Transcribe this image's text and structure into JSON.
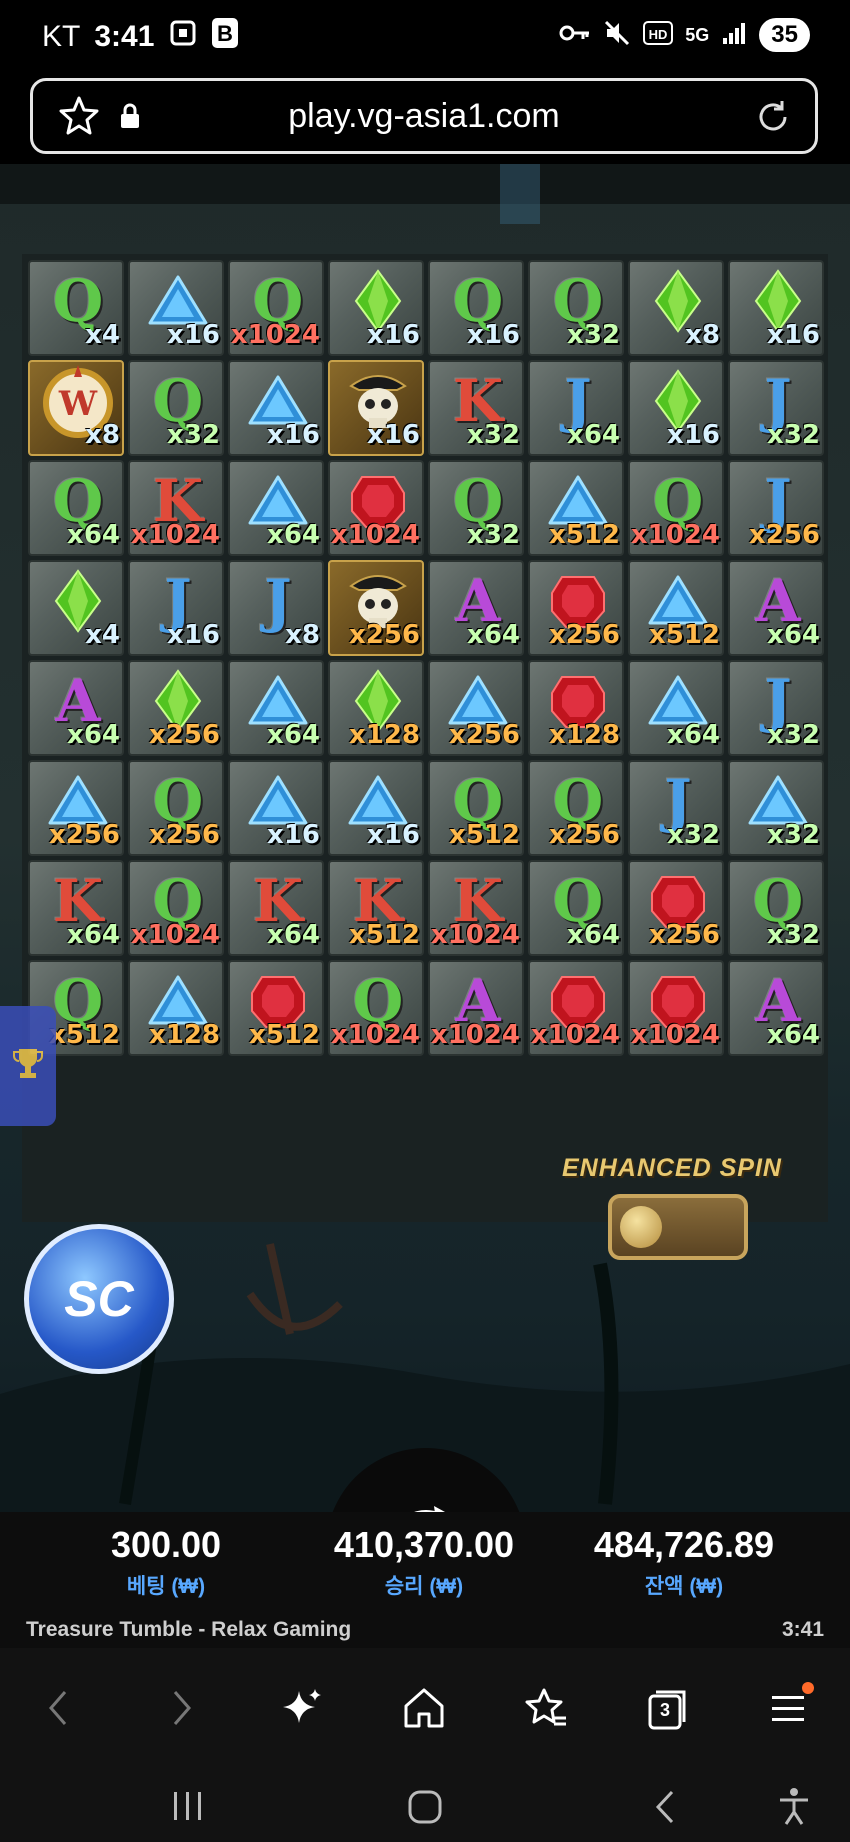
{
  "status_bar": {
    "carrier": "KT",
    "time": "3:41",
    "network": "5G",
    "battery": "35"
  },
  "browser": {
    "url": "play.vg-asia1.com"
  },
  "grid": {
    "rows": [
      [
        {
          "s": "Q",
          "m": "x4"
        },
        {
          "s": "tri",
          "m": "x16"
        },
        {
          "s": "Q",
          "m": "x1024"
        },
        {
          "s": "gem",
          "m": "x16"
        },
        {
          "s": "Q",
          "m": "x16"
        },
        {
          "s": "Q",
          "m": "x32"
        },
        {
          "s": "gem",
          "m": "x8"
        },
        {
          "s": "gem",
          "m": "x16"
        }
      ],
      [
        {
          "s": "W",
          "m": "x8"
        },
        {
          "s": "Q",
          "m": "x32"
        },
        {
          "s": "tri",
          "m": "x16"
        },
        {
          "s": "skull",
          "m": "x16"
        },
        {
          "s": "K",
          "m": "x32"
        },
        {
          "s": "J",
          "m": "x64"
        },
        {
          "s": "gem",
          "m": "x16"
        },
        {
          "s": "J",
          "m": "x32"
        }
      ],
      [
        {
          "s": "Q",
          "m": "x64"
        },
        {
          "s": "K",
          "m": "x1024"
        },
        {
          "s": "tri",
          "m": "x64"
        },
        {
          "s": "ruby",
          "m": "x1024"
        },
        {
          "s": "Q",
          "m": "x32"
        },
        {
          "s": "tri",
          "m": "x512"
        },
        {
          "s": "Q",
          "m": "x1024"
        },
        {
          "s": "J",
          "m": "x256"
        }
      ],
      [
        {
          "s": "gem",
          "m": "x4"
        },
        {
          "s": "J",
          "m": "x16"
        },
        {
          "s": "J",
          "m": "x8"
        },
        {
          "s": "skull",
          "m": "x256"
        },
        {
          "s": "A",
          "m": "x64"
        },
        {
          "s": "ruby",
          "m": "x256"
        },
        {
          "s": "tri",
          "m": "x512"
        },
        {
          "s": "A",
          "m": "x64"
        }
      ],
      [
        {
          "s": "A",
          "m": "x64"
        },
        {
          "s": "gem",
          "m": "x256"
        },
        {
          "s": "tri",
          "m": "x64"
        },
        {
          "s": "gem",
          "m": "x128"
        },
        {
          "s": "tri",
          "m": "x256"
        },
        {
          "s": "ruby",
          "m": "x128"
        },
        {
          "s": "tri",
          "m": "x64"
        },
        {
          "s": "J",
          "m": "x32"
        }
      ],
      [
        {
          "s": "tri",
          "m": "x256"
        },
        {
          "s": "Q",
          "m": "x256"
        },
        {
          "s": "tri",
          "m": "x16"
        },
        {
          "s": "tri",
          "m": "x16"
        },
        {
          "s": "Q",
          "m": "x512"
        },
        {
          "s": "Q",
          "m": "x256"
        },
        {
          "s": "J",
          "m": "x32"
        },
        {
          "s": "tri",
          "m": "x32"
        }
      ],
      [
        {
          "s": "K",
          "m": "x64"
        },
        {
          "s": "Q",
          "m": "x1024"
        },
        {
          "s": "K",
          "m": "x64"
        },
        {
          "s": "K",
          "m": "x512"
        },
        {
          "s": "K",
          "m": "x1024"
        },
        {
          "s": "Q",
          "m": "x64"
        },
        {
          "s": "ruby",
          "m": "x256"
        },
        {
          "s": "Q",
          "m": "x32"
        }
      ],
      [
        {
          "s": "Q",
          "m": "x512"
        },
        {
          "s": "tri",
          "m": "x128"
        },
        {
          "s": "ruby",
          "m": "x512"
        },
        {
          "s": "Q",
          "m": "x1024"
        },
        {
          "s": "A",
          "m": "x1024"
        },
        {
          "s": "ruby",
          "m": "x1024"
        },
        {
          "s": "ruby",
          "m": "x1024"
        },
        {
          "s": "A",
          "m": "x64"
        }
      ]
    ]
  },
  "enhanced_spin": {
    "label": "ENHANCED SPIN",
    "enabled": false
  },
  "badge": {
    "label": "SC"
  },
  "stats": {
    "bet": {
      "value": "300.00",
      "label": "베팅 (₩)"
    },
    "win": {
      "value": "410,370.00",
      "label": "승리 (₩)"
    },
    "balance": {
      "value": "484,726.89",
      "label": "잔액 (₩)"
    }
  },
  "game_bar": {
    "title": "Treasure Tumble - Relax Gaming",
    "time": "3:41"
  },
  "browser_nav": {
    "tabs_count": "3"
  },
  "colors": {
    "stat_label": "#58a8ff",
    "enhanced": "#e8c870"
  }
}
